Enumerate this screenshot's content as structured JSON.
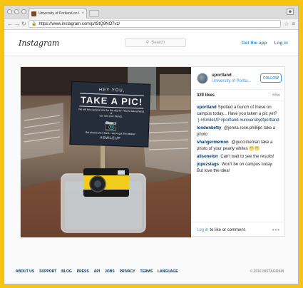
{
  "browser": {
    "tab_title": "University of Portland on I...",
    "tab_close": "×",
    "url": "https://www.instagram.com/p/tStQ9NO7vz/"
  },
  "header": {
    "logo": "Instagram",
    "search_placeholder": "Search",
    "get_app": "Get the app",
    "login": "Log in"
  },
  "photo": {
    "sign_line1": "HEY YOU,",
    "sign_line2": "TAKE A PIC!",
    "sign_small1": "We left this camera here for the day for YOU to take photos of",
    "sign_small2": "you and your friends.",
    "sign_small3": "But please put it back - we've got film please!",
    "sign_hashtag": "#SMILEUP"
  },
  "post": {
    "username": "uportland",
    "location": "University of Portla...",
    "follow_label": "FOLLOW",
    "likes": "329 likes",
    "time_ago": "66w",
    "comments": [
      {
        "user": "uportland",
        "text": "Spotted a bunch of these on campus today... Have you taken a pic yet? :) ",
        "tags": "#SmileUP #portland #universityofportland"
      },
      {
        "user": "londonbetty",
        "text": "@jenna.rose.phillips take a photo",
        "tags": ""
      },
      {
        "user": "shangermemon",
        "text": "@guccimeman take a photo of your pearly whites 😁😁",
        "tags": ""
      },
      {
        "user": "allsonelon",
        "text": "Can't wait to see the results!",
        "tags": ""
      },
      {
        "user": "jopezstags",
        "text": "Won't be on campus today. But love the idea!",
        "tags": ""
      }
    ],
    "login_link": "Log in",
    "login_suffix": "to like or comment.",
    "more": "•••"
  },
  "footer": {
    "links": [
      "ABOUT US",
      "SUPPORT",
      "BLOG",
      "PRESS",
      "API",
      "JOBS",
      "PRIVACY",
      "TERMS",
      "LANGUAGE"
    ],
    "copyright": "© 2016 INSTAGRAM"
  }
}
